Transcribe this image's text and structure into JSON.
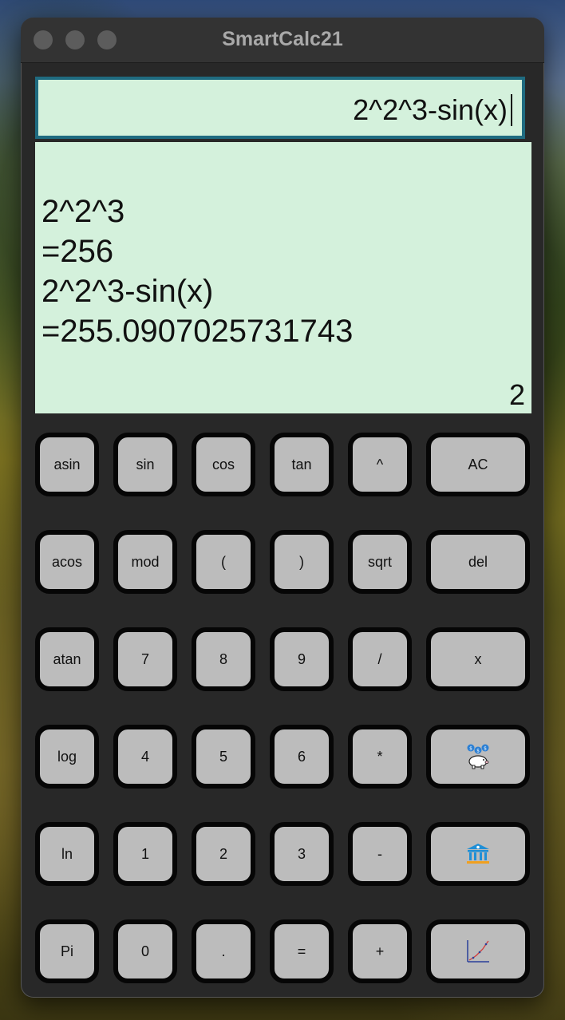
{
  "window": {
    "title": "SmartCalc21"
  },
  "input": {
    "expression": "2^2^3-sin(x)"
  },
  "output": {
    "lines": [
      "2^2^3",
      "=256",
      "2^2^3-sin(x)",
      "=255.0907025731743"
    ],
    "counter": "2"
  },
  "keys": {
    "asin": "asin",
    "sin": "sin",
    "cos": "cos",
    "tan": "tan",
    "pow": "^",
    "ac": "AC",
    "acos": "acos",
    "mod": "mod",
    "lparen": "(",
    "rparen": ")",
    "sqrt": "sqrt",
    "del": "del",
    "atan": "atan",
    "d7": "7",
    "d8": "8",
    "d9": "9",
    "div": "/",
    "x": "x",
    "log": "log",
    "d4": "4",
    "d5": "5",
    "d6": "6",
    "mul": "*",
    "ln": "ln",
    "d1": "1",
    "d2": "2",
    "d3": "3",
    "minus": "-",
    "pi": "Pi",
    "d0": "0",
    "dot": ".",
    "equals": "=",
    "plus": "+"
  },
  "icons": {
    "credit": "piggy-bank-icon",
    "deposit": "bank-icon",
    "graph": "graph-icon"
  },
  "colors": {
    "display_bg": "#d4f1dc",
    "input_border": "#1f6b80",
    "key_bg": "#bcbcbc",
    "window_bg": "#282828"
  }
}
